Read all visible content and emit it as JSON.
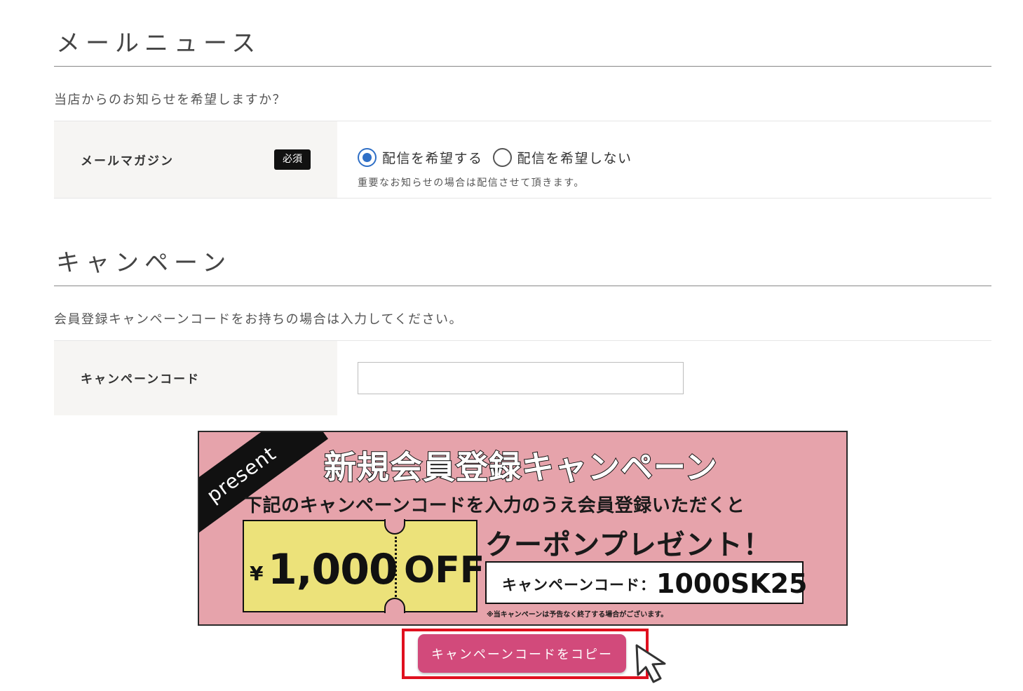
{
  "mail_news": {
    "title": "メールニュース",
    "intro": "当店からのお知らせを希望しますか？",
    "field_label": "メールマガジン",
    "required_badge": "必須",
    "options": [
      {
        "label": "配信を希望する",
        "checked": true
      },
      {
        "label": "配信を希望しない",
        "checked": false
      }
    ],
    "note": "重要なお知らせの場合は配信させて頂きます。"
  },
  "campaign": {
    "title": "キャンペーン",
    "intro": "会員登録キャンペーンコードをお持ちの場合は入力してください。",
    "field_label": "キャンペーンコード",
    "input_value": ""
  },
  "banner": {
    "corner_text": "present",
    "title": "新規会員登録キャンペーン",
    "subtitle": "下記のキャンペーンコードを入力のうえ会員登録いただくと",
    "yen": "¥",
    "amount": "1,000",
    "off": "OFF",
    "coupon_heading": "クーポンプレゼント！",
    "code_label": "キャンペーンコード：",
    "code_value": "1000SK25",
    "note": "※当キャンペーンは予告なく終了する場合がございます。",
    "colors": {
      "background": "#e6a3ab",
      "ticket": "#ece27a"
    }
  },
  "copy_button": {
    "label": "キャンペーンコードをコピー",
    "color": "#d24a7b",
    "highlight_color": "#e0101e"
  },
  "cursor_icon": "arrow-cursor-icon"
}
